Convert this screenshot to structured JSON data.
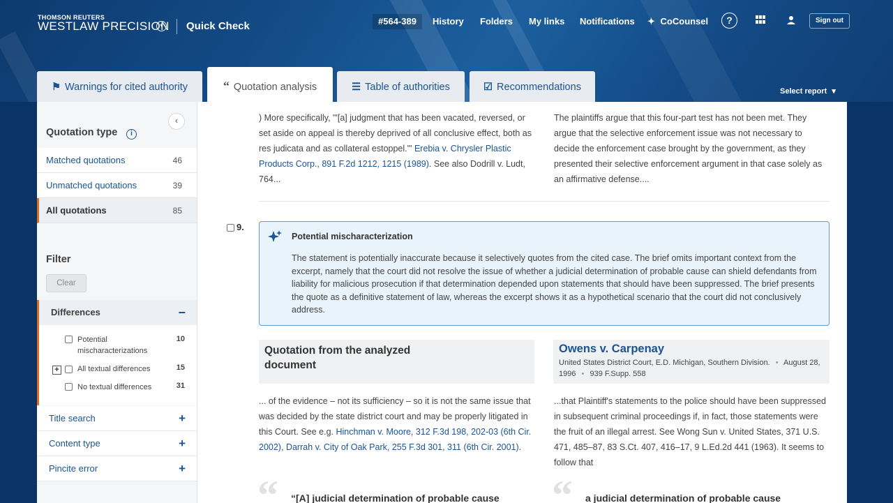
{
  "header": {
    "brand_top": "THOMSON REUTERS",
    "brand_main": "WESTLAW PRECISION",
    "product": "Quick Check",
    "client_id": "#564-389",
    "nav": {
      "history": "History",
      "folders": "Folders",
      "my_links": "My links",
      "notifications": "Notifications",
      "cocounsel": "CoCounsel"
    },
    "help": "?",
    "sign_out": "Sign out"
  },
  "tabs": [
    {
      "label": "Warnings for cited authority",
      "icon": "flag-icon"
    },
    {
      "label": "Quotation analysis",
      "icon": "quote-icon",
      "active": true
    },
    {
      "label": "Table of authorities",
      "icon": "list-icon"
    },
    {
      "label": "Recommendations",
      "icon": "checkbox-icon"
    }
  ],
  "select_report": "Select report",
  "sidebar": {
    "quotation_type_title": "Quotation type",
    "quotation_types": [
      {
        "label": "Matched quotations",
        "count": "46"
      },
      {
        "label": "Unmatched quotations",
        "count": "39"
      },
      {
        "label": "All quotations",
        "count": "85",
        "active": true
      }
    ],
    "filter_title": "Filter",
    "clear_label": "Clear",
    "differences": {
      "title": "Differences",
      "items": [
        {
          "label": "Potential mischaracterizations",
          "count": "10"
        },
        {
          "label": "All textual differences",
          "count": "15"
        },
        {
          "label": "No textual differences",
          "count": "31"
        }
      ]
    },
    "collapsed": [
      "Title search",
      "Content type",
      "Pincite error"
    ]
  },
  "main": {
    "top_left": {
      "before": ") More specifically, \"'[a] judgment that has been vacated, reversed, or set aside on appeal is thereby deprived of all conclusive effect, both as res judicata and as collateral estoppel.'\" ",
      "link": "Erebia v. Chrysler Plastic Products Corp., 891 F.2d 1212, 1215 (1989)",
      "after": ". See also Dodrill v. Ludt, 764..."
    },
    "top_right": "The plaintiffs argue that this four-part test has not been met. They argue that the selective enforcement issue was not necessary to decide the enforcement case brought by the government, as they presented their selective enforcement argument in that case solely as an affirmative defense....",
    "item_number": "9.",
    "alert": {
      "title": "Potential mischaracterization",
      "body": "The statement is potentially inaccurate because it selectively quotes from the cited case. The brief omits important context from the excerpt, namely that the court did not resolve the issue of whether a judicial determination of probable cause can shield defendants from liability for malicious prosecution if that determination depended upon statements that should have been suppressed. The brief presents the quote as a definitive statement of law, whereas the excerpt shows it as a hypothetical scenario that the court did not conclusively address."
    },
    "left_panel": {
      "title": "Quotation from the analyzed document",
      "text_before": "... of the evidence – not its sufficiency – so it is not the same issue that was decided by the state district court and may be properly litigated in this Court. See e.g. ",
      "link1": "Hinchman v. Moore, 312 F.3d 198, 202-03 (6th Cir. 2002)",
      "sep": ", ",
      "link2": "Darrah v. City of Oak Park, 255 F.3d 301, 311 (6th Cir. 2001)",
      "text_after": ".",
      "quote": "“[A] judicial determination of probable cause"
    },
    "right_panel": {
      "case_name": "Owens v. Carpenay",
      "court": "United States District Court, E.D. Michigan, Southern Division.",
      "date": "August 28, 1996",
      "citation": "939 F.Supp. 558",
      "dot": "•",
      "text": "...that Plaintiff's statements to the police should have been suppressed in subsequent criminal proceedings if, in fact, those statements were the fruit of an illegal arrest. See Wong Sun v. United States, 371 U.S. 471, 485–87, 83 S.Ct. 407, 416–17, 9 L.Ed.2d 441 (1963). It seems to follow that",
      "quote": "a judicial determination of probable cause"
    }
  },
  "colors": {
    "accent_orange": "#e36c23",
    "link_blue": "#1a5494",
    "header_navy": "#0d3a6e",
    "alert_bg": "#e8f3fc",
    "alert_border": "#5b9bd5"
  }
}
